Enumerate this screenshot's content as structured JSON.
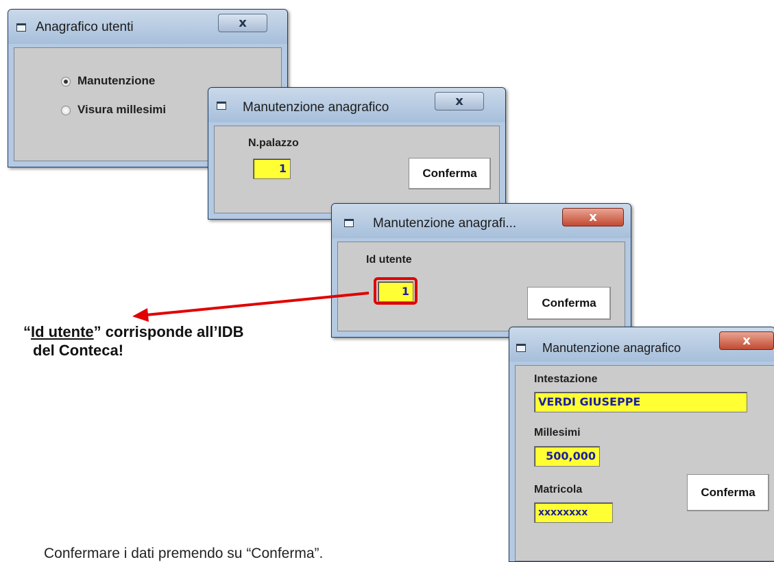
{
  "window1": {
    "title": "Anagrafico utenti",
    "close_label": "x",
    "options": [
      {
        "label": "Manutenzione",
        "selected": true
      },
      {
        "label": "Visura millesimi",
        "selected": false
      }
    ]
  },
  "window2": {
    "title": "Manutenzione anagrafico",
    "close_label": "x",
    "field_label": "N.palazzo",
    "field_value": "1",
    "confirm_label": "Conferma"
  },
  "window3": {
    "title": "Manutenzione anagrafi...",
    "close_label": "x",
    "field_label": "Id utente",
    "field_value": "1",
    "confirm_label": "Conferma"
  },
  "window4": {
    "title": "Manutenzione anagrafico",
    "close_label": "x",
    "intestazione_label": "Intestazione",
    "intestazione_value": "VERDI GIUSEPPE",
    "millesimi_label": "Millesimi",
    "millesimi_value": "500,000",
    "matricola_label": "Matricola",
    "matricola_value": "xxxxxxxx",
    "confirm_label": "Conferma"
  },
  "annotation": {
    "open_quote": "“",
    "term": "Id utente",
    "rest_line1": "” corrisponde all’IDB",
    "line2": "del Conteca!"
  },
  "caption": "Confermare i dati premendo su “Conferma”.",
  "colors": {
    "field_bg": "#ffff33",
    "field_text": "#1c1fa0",
    "highlight": "#e00000"
  }
}
